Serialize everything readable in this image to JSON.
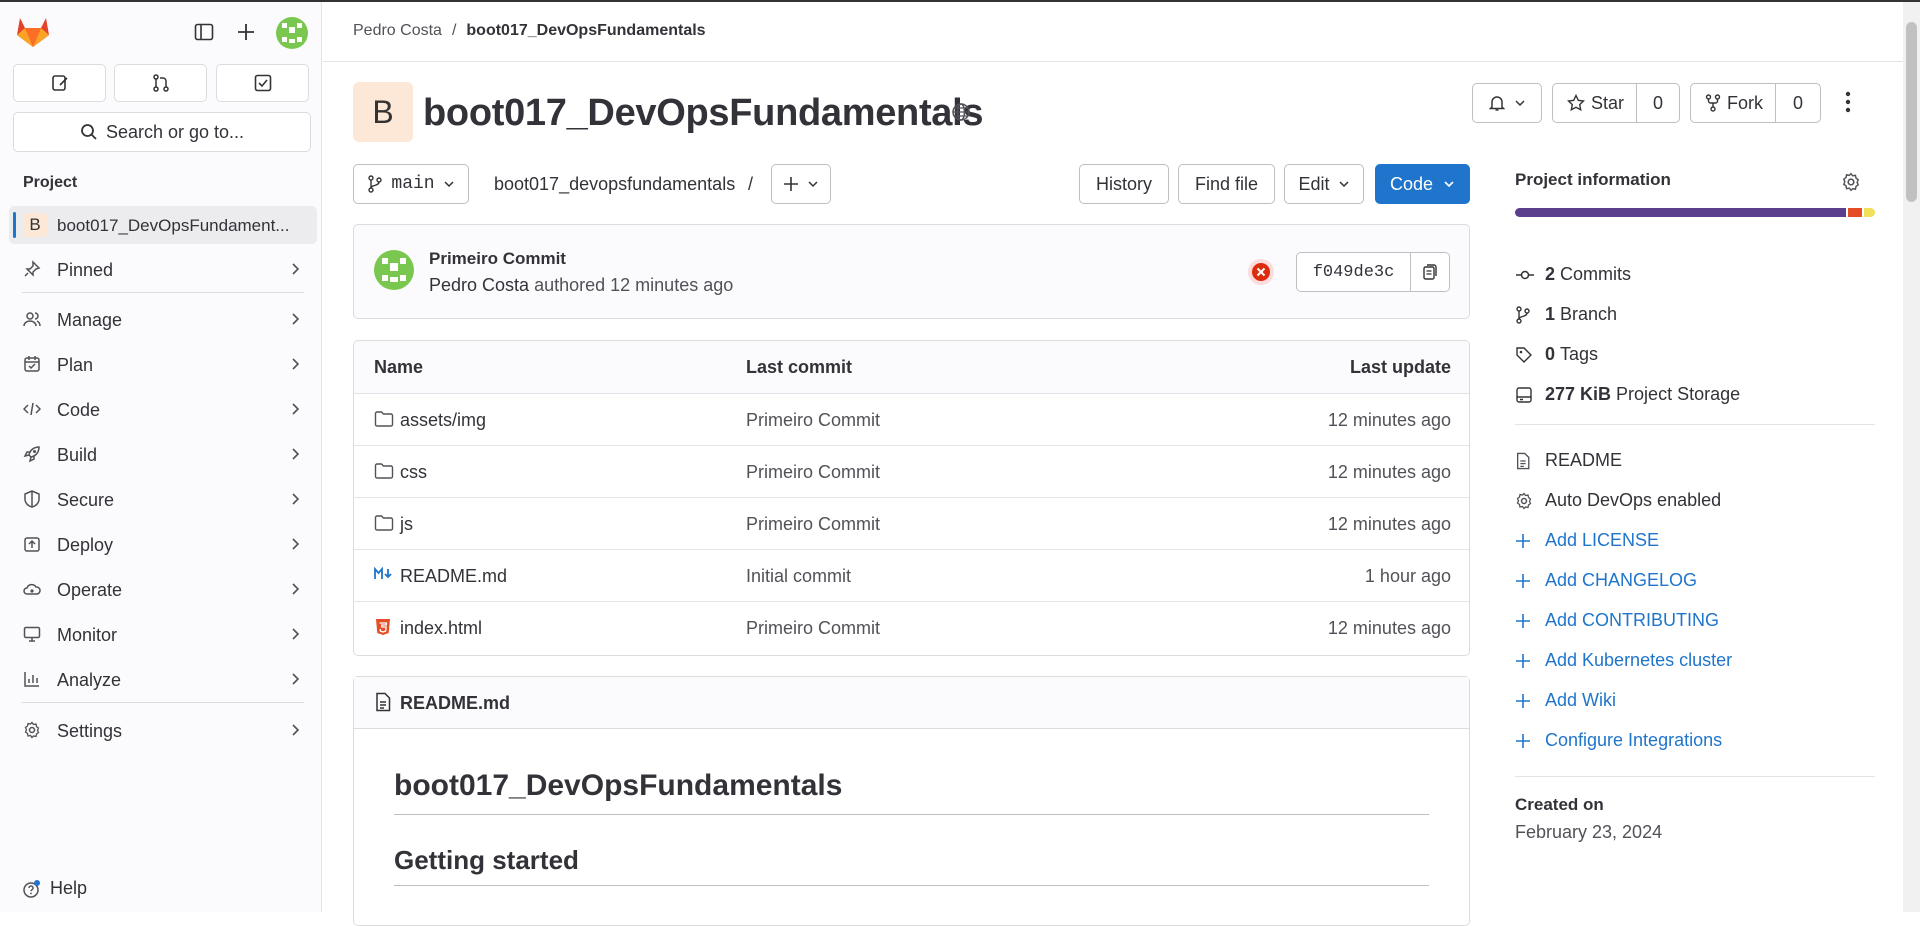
{
  "sidebar": {
    "search_placeholder": "Search or go to...",
    "section_label": "Project",
    "project_initial": "B",
    "project_name": "boot017_DevOpsFundament...",
    "items": [
      {
        "label": "Pinned",
        "icon": "pin-icon"
      },
      {
        "label": "Manage",
        "icon": "users-icon"
      },
      {
        "label": "Plan",
        "icon": "planning-icon"
      },
      {
        "label": "Code",
        "icon": "code-icon"
      },
      {
        "label": "Build",
        "icon": "rocket-icon"
      },
      {
        "label": "Secure",
        "icon": "shield-icon"
      },
      {
        "label": "Deploy",
        "icon": "deployments-icon"
      },
      {
        "label": "Operate",
        "icon": "cloud-gear-icon"
      },
      {
        "label": "Monitor",
        "icon": "monitor-icon"
      },
      {
        "label": "Analyze",
        "icon": "chart-icon"
      },
      {
        "label": "Settings",
        "icon": "gear-icon"
      }
    ],
    "help_label": "Help"
  },
  "breadcrumb": {
    "owner": "Pedro Costa",
    "separator": "/",
    "project": "boot017_DevOpsFundamentals"
  },
  "project": {
    "initial": "B",
    "title": "boot017_DevOpsFundamentals",
    "star_label": "Star",
    "star_count": "0",
    "fork_label": "Fork",
    "fork_count": "0"
  },
  "toolbar": {
    "branch": "main",
    "path": "boot017_devopsfundamentals",
    "path_sep": "/",
    "history": "History",
    "find_file": "Find file",
    "edit": "Edit",
    "code": "Code"
  },
  "last_commit": {
    "title": "Primeiro Commit",
    "author": "Pedro Costa",
    "action": "authored",
    "time": "12 minutes ago",
    "sha": "f049de3c",
    "pipeline_status": "failed"
  },
  "files": {
    "headers": {
      "name": "Name",
      "commit": "Last commit",
      "update": "Last update"
    },
    "rows": [
      {
        "name": "assets/img",
        "type": "folder",
        "commit": "Primeiro Commit",
        "update": "12 minutes ago"
      },
      {
        "name": "css",
        "type": "folder",
        "commit": "Primeiro Commit",
        "update": "12 minutes ago"
      },
      {
        "name": "js",
        "type": "folder",
        "commit": "Primeiro Commit",
        "update": "12 minutes ago"
      },
      {
        "name": "README.md",
        "type": "markdown",
        "commit": "Initial commit",
        "update": "1 hour ago"
      },
      {
        "name": "index.html",
        "type": "html",
        "commit": "Primeiro Commit",
        "update": "12 minutes ago"
      }
    ]
  },
  "readme": {
    "filename": "README.md",
    "h1": "boot017_DevOpsFundamentals",
    "h2": "Getting started"
  },
  "project_info": {
    "title": "Project information",
    "language_colors": [
      "#5b3f8c",
      "#e44d26",
      "#f1e05a"
    ],
    "language_shares": [
      0.93,
      0.04,
      0.03
    ],
    "stats": [
      {
        "count": "2",
        "label": "Commits",
        "icon": "commit-icon"
      },
      {
        "count": "1",
        "label": "Branch",
        "icon": "branch-icon"
      },
      {
        "count": "0",
        "label": "Tags",
        "icon": "tag-icon"
      },
      {
        "count": "277 KiB",
        "label": "Project Storage",
        "icon": "storage-icon"
      }
    ],
    "links": [
      {
        "label": "README",
        "icon": "doc-icon",
        "link": false
      },
      {
        "label": "Auto DevOps enabled",
        "icon": "gear-icon",
        "link": false
      },
      {
        "label": "Add LICENSE",
        "icon": "plus-icon",
        "link": true
      },
      {
        "label": "Add CHANGELOG",
        "icon": "plus-icon",
        "link": true
      },
      {
        "label": "Add CONTRIBUTING",
        "icon": "plus-icon",
        "link": true
      },
      {
        "label": "Add Kubernetes cluster",
        "icon": "plus-icon",
        "link": true
      },
      {
        "label": "Add Wiki",
        "icon": "plus-icon",
        "link": true
      },
      {
        "label": "Configure Integrations",
        "icon": "plus-icon",
        "link": true
      }
    ],
    "created_label": "Created on",
    "created_date": "February 23, 2024"
  }
}
